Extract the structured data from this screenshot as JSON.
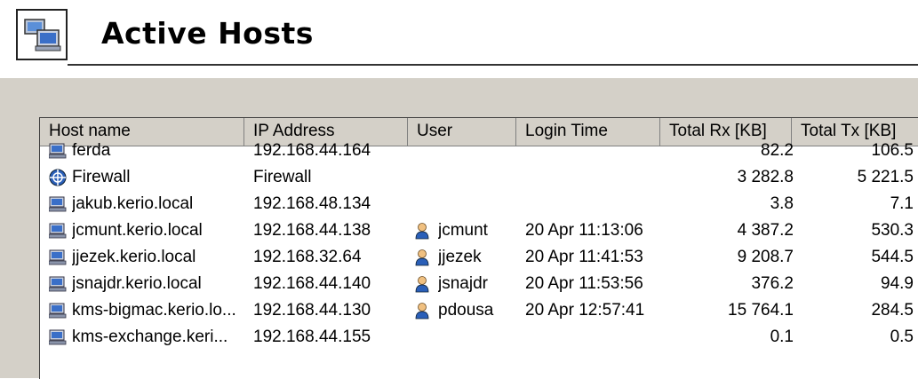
{
  "page": {
    "title": "Active Hosts"
  },
  "icons": {
    "header": "computers-icon",
    "host": "computer-icon",
    "firewall": "firewall-icon",
    "user": "user-icon"
  },
  "table": {
    "columns": [
      "Host name",
      "IP Address",
      "User",
      "Login Time",
      "Total Rx [KB]",
      "Total Tx [KB]"
    ],
    "rows": [
      {
        "icon": "computer-icon",
        "host": "ferda",
        "ip": "192.168.44.164",
        "user": "",
        "login": "",
        "rx": "82.2",
        "tx": "106.5"
      },
      {
        "icon": "firewall-icon",
        "host": "Firewall",
        "ip": "Firewall",
        "user": "",
        "login": "",
        "rx": "3 282.8",
        "tx": "5 221.5"
      },
      {
        "icon": "computer-icon",
        "host": "jakub.kerio.local",
        "ip": "192.168.48.134",
        "user": "",
        "login": "",
        "rx": "3.8",
        "tx": "7.1"
      },
      {
        "icon": "computer-icon",
        "host": "jcmunt.kerio.local",
        "ip": "192.168.44.138",
        "user": "jcmunt",
        "login": "20 Apr 11:13:06",
        "rx": "4 387.2",
        "tx": "530.3"
      },
      {
        "icon": "computer-icon",
        "host": "jjezek.kerio.local",
        "ip": "192.168.32.64",
        "user": "jjezek",
        "login": "20 Apr 11:41:53",
        "rx": "9 208.7",
        "tx": "544.5"
      },
      {
        "icon": "computer-icon",
        "host": "jsnajdr.kerio.local",
        "ip": "192.168.44.140",
        "user": "jsnajdr",
        "login": "20 Apr 11:53:56",
        "rx": "376.2",
        "tx": "94.9"
      },
      {
        "icon": "computer-icon",
        "host": "kms-bigmac.kerio.lo...",
        "ip": "192.168.44.130",
        "user": "pdousa",
        "login": "20 Apr 12:57:41",
        "rx": "15 764.1",
        "tx": "284.5"
      },
      {
        "icon": "computer-icon",
        "host": "kms-exchange.keri...",
        "ip": "192.168.44.155",
        "user": "",
        "login": "",
        "rx": "0.1",
        "tx": "0.5"
      }
    ]
  }
}
